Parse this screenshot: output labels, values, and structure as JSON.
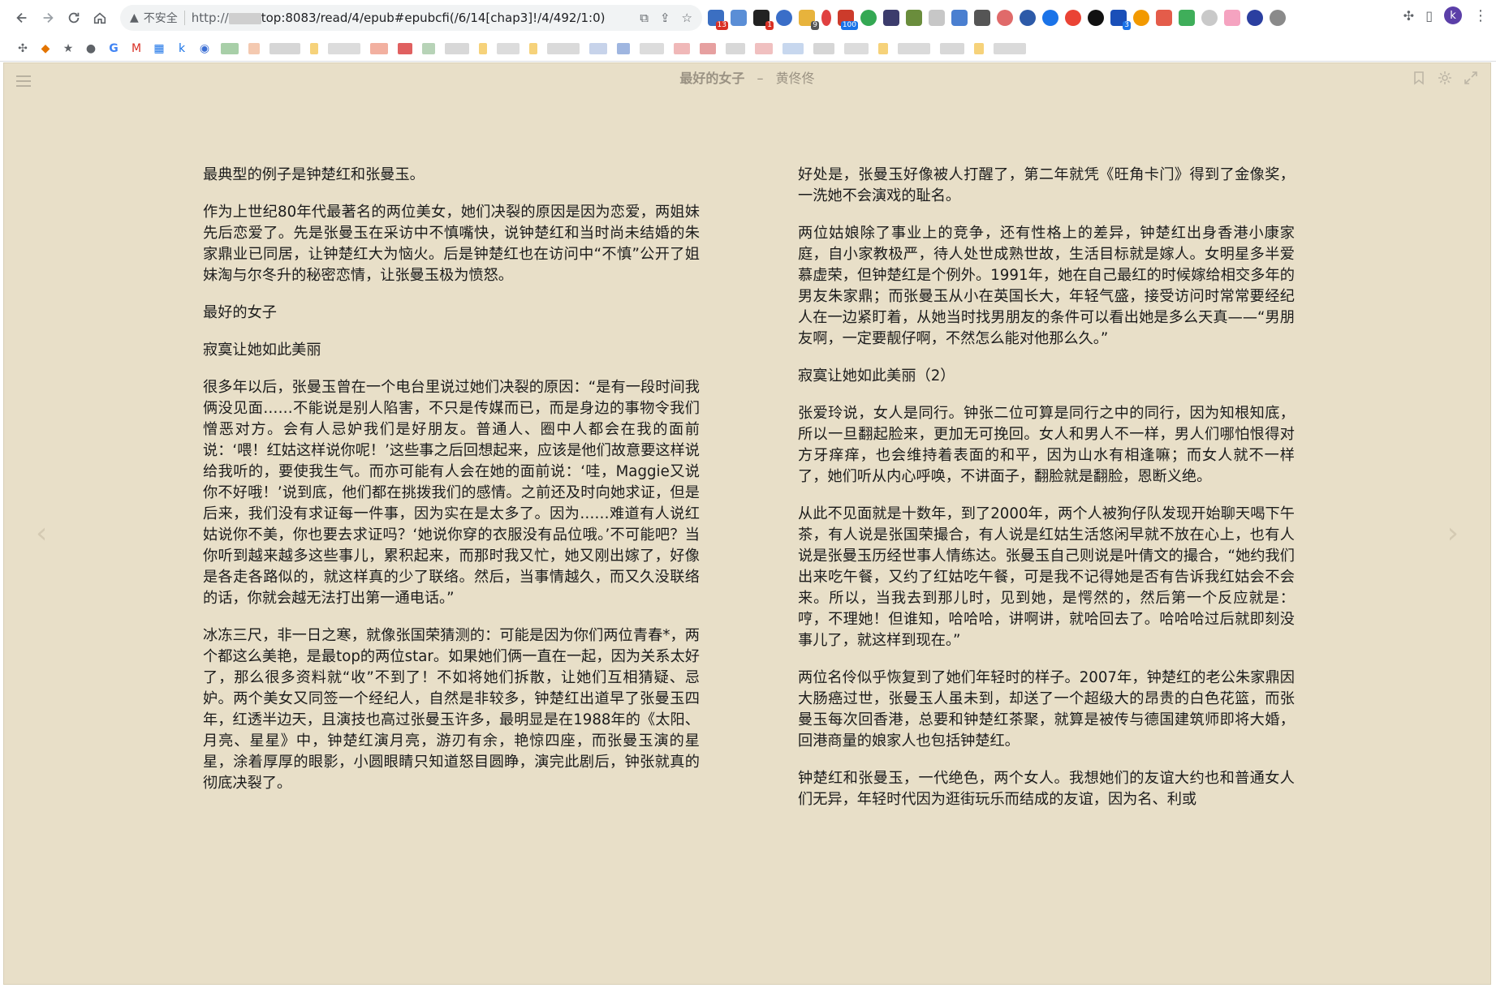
{
  "browser": {
    "security_label": "不安全",
    "url_prefix": "http://",
    "url_rest": "top:8083/read/4/epub#epubcfi(/6/14[chap3]!/4/492/1:0)",
    "profile_initial": "k",
    "extension_badges": [
      "13",
      "1",
      "9",
      "100",
      "3"
    ]
  },
  "reader": {
    "book_title": "最好的女子",
    "separator": "–",
    "author": "黄佟佟",
    "left_column": [
      "最典型的例子是钟楚红和张曼玉。",
      "作为上世纪80年代最著名的两位美女，她们决裂的原因是因为恋爱，两姐妹先后恋爱了。先是张曼玉在采访中不慎嘴快，说钟楚红和当时尚未结婚的朱家鼎业已同居，让钟楚红大为恼火。后是钟楚红也在访问中“不慎”公开了姐妹淘与尔冬升的秘密恋情，让张曼玉极为愤怒。",
      "最好的女子",
      "寂寞让她如此美丽",
      "很多年以后，张曼玉曾在一个电台里说过她们决裂的原因：“是有一段时间我俩没见面……不能说是别人陷害，不只是传媒而已，而是身边的事物令我们憎恶对方。会有人忌妒我们是好朋友。普通人、圈中人都会在我的面前说：‘喂！红姑这样说你呢！’这些事之后回想起来，应该是他们故意要这样说给我听的，要使我生气。而亦可能有人会在她的面前说：‘哇，Maggie又说你不好哦！’说到底，他们都在挑拨我们的感情。之前还及时向她求证，但是后来，我们没有求证每一件事，因为实在是太多了。因为……难道有人说红姑说你不美，你也要去求证吗？‘她说你穿的衣服没有品位哦。’不可能吧？当你听到越来越多这些事儿，累积起来，而那时我又忙，她又刚出嫁了，好像是各走各路似的，就这样真的少了联络。然后，当事情越久，而又久没联络的话，你就会越无法打出第一通电话。”",
      "冰冻三尺，非一日之寒，就像张国荣猜测的：可能是因为你们两位青春*，两个都这么美艳，是最top的两位star。如果她们俩一直在一起，因为关系太好了，那么很多资料就“收”不到了！不如将她们拆散，让她们互相猜疑、忌妒。两个美女又同签一个经纪人，自然是非较多，钟楚红出道早了张曼玉四年，红透半边天，且演技也高过张曼玉许多，最明显是在1988年的《太阳、月亮、星星》中，钟楚红演月亮，游刃有余，艳惊四座，而张曼玉演的星星，涂着厚厚的眼影，小圆眼睛只知道怒目圆睁，演完此剧后，钟张就真的彻底决裂了。"
    ],
    "right_column": [
      "好处是，张曼玉好像被人打醒了，第二年就凭《旺角卡门》得到了金像奖，一洗她不会演戏的耻名。",
      "两位姑娘除了事业上的竞争，还有性格上的差异，钟楚红出身香港小康家庭，自小家教极严，待人处世成熟世故，生活目标就是嫁人。女明星多半爱慕虚荣，但钟楚红是个例外。1991年，她在自己最红的时候嫁给相交多年的男友朱家鼎；而张曼玉从小在英国长大，年轻气盛，接受访问时常常要经纪人在一边紧盯着，从她当时找男朋友的条件可以看出她是多么天真——“男朋友啊，一定要靓仔啊，不然怎么能对他那么久。”",
      "寂寞让她如此美丽（2）",
      "张爱玲说，女人是同行。钟张二位可算是同行之中的同行，因为知根知底，所以一旦翻起脸来，更加无可挽回。女人和男人不一样，男人们哪怕恨得对方牙痒痒，也会维持着表面的和平，因为山水有相逢嘛；而女人就不一样了，她们听从内心呼唤，不讲面子，翻脸就是翻脸，恩断义绝。",
      "从此不见面就是十数年，到了2000年，两个人被狗仔队发现开始聊天喝下午茶，有人说是张国荣撮合，有人说是红姑生活悠闲早就不放在心上，也有人说是张曼玉历经世事人情练达。张曼玉自己则说是叶倩文的撮合，“她约我们出来吃午餐，又约了红姑吃午餐，可是我不记得她是否有告诉我红姑会不会来。所以，当我去到那儿时，见到她，是愕然的，然后第一个反应就是：哼，不理她！但谁知，哈哈哈，讲啊讲，就哈回去了。哈哈哈过后就即刻没事儿了，就这样到现在。”",
      "两位名伶似乎恢复到了她们年轻时的样子。2007年，钟楚红的老公朱家鼎因大肠癌过世，张曼玉人虽未到，却送了一个超级大的昂贵的白色花篮，而张曼玉每次回香港，总要和钟楚红茶聚，就算是被传与德国建筑师即将大婚，回港商量的娘家人也包括钟楚红。",
      "钟楚红和张曼玉，一代绝色，两个女人。我想她们的友谊大约也和普通女人们无异，年轻时代因为逛街玩乐而结成的友谊，因为名、利或"
    ]
  }
}
